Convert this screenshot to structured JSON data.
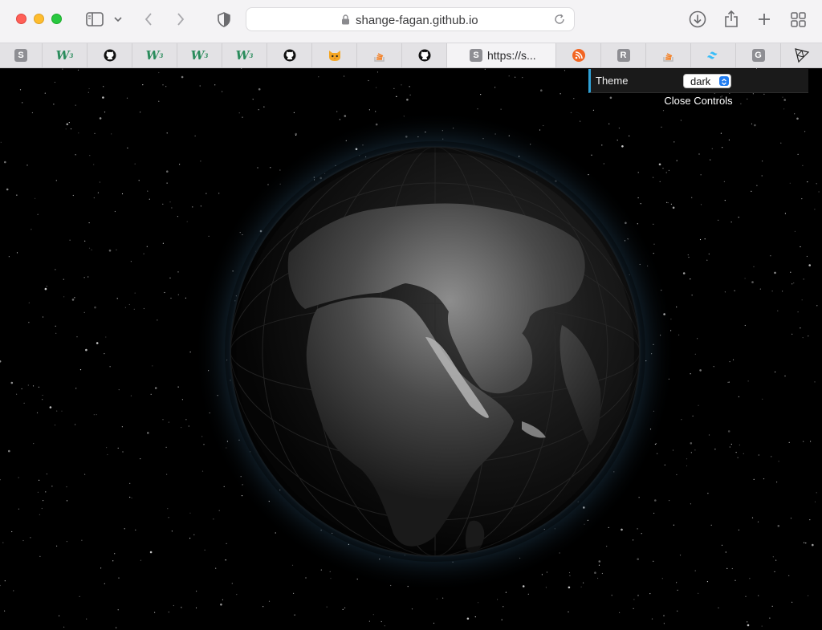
{
  "browser": {
    "address_bar": {
      "url": "shange-fagan.github.io"
    },
    "tabs": [
      {
        "icon": "s-favicon",
        "letter": "S"
      },
      {
        "icon": "w3-favicon",
        "letter": "W"
      },
      {
        "icon": "github-icon"
      },
      {
        "icon": "w3-favicon",
        "letter": "W"
      },
      {
        "icon": "w3-favicon",
        "letter": "W"
      },
      {
        "icon": "w3-favicon",
        "letter": "W"
      },
      {
        "icon": "github-icon"
      },
      {
        "icon": "cat-favicon"
      },
      {
        "icon": "stackoverflow-icon"
      },
      {
        "icon": "github-icon"
      },
      {
        "icon": "s-favicon",
        "letter": "S",
        "label": "https://s...",
        "active": true
      },
      {
        "icon": "rss-icon"
      },
      {
        "icon": "r-favicon",
        "letter": "R"
      },
      {
        "icon": "stackoverflow-icon"
      },
      {
        "icon": "tailwind-icon"
      },
      {
        "icon": "g-favicon",
        "letter": "G"
      },
      {
        "icon": "threejs-icon"
      }
    ]
  },
  "controls": {
    "theme_label": "Theme",
    "theme_value": "dark",
    "close_label": "Close Controls",
    "accent": "#2fa1d6"
  }
}
